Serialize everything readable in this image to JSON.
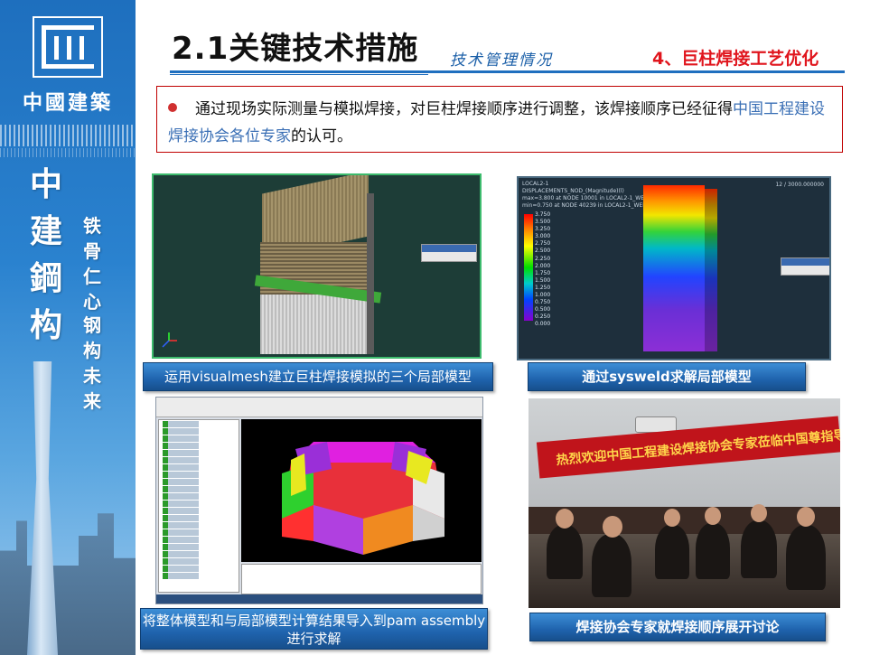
{
  "sidebar": {
    "brand_cn": "中國建築",
    "big_chars": [
      "中",
      "建",
      "鋼",
      "构"
    ],
    "motto_col1": [
      "铁",
      "骨",
      "仁",
      "心"
    ],
    "motto_col2": [
      "钢",
      "构",
      "未",
      "来"
    ]
  },
  "header": {
    "title": "2.1关键技术措施",
    "subtitle": "技术管理情况",
    "section_label": "4、巨柱焊接工艺优化"
  },
  "intro": {
    "text_main": "通过现场实际测量与模拟焊接，对巨柱焊接顺序进行调整，该焊接顺序已经征得",
    "text_highlight": "中国工程建设焊接协会各位专家",
    "text_end": "的认可。"
  },
  "panels": {
    "cap1": "运用visualmesh建立巨柱焊接模拟的三个局部模型",
    "cap2": "通过sysweld求解局部模型",
    "cap3": "将整体模型和与局部模型计算结果导入到pam assembly 进行求解",
    "cap4": "焊接协会专家就焊接顺序展开讨论"
  },
  "img2": {
    "header_lines": [
      "LOCAL2-1",
      "DISPLACEMENTS_NOD_(Magnitude)(l)",
      "max=3.800 at NODE 10001 in LOCAL2-1_WELD_4_POST3000.fdb",
      "min=0.750 at NODE 40239 in LOCAL2-1_WELD_4_POST3000.fdb"
    ],
    "frame": "12 / 3000.000000",
    "legend_values": [
      "3.750",
      "3.500",
      "3.250",
      "3.000",
      "2.750",
      "2.500",
      "2.250",
      "2.000",
      "1.750",
      "1.500",
      "1.250",
      "1.000",
      "0.750",
      "0.500",
      "0.250",
      "0.000"
    ]
  },
  "img4": {
    "banner": "热烈欢迎中国工程建设焊接协会专家莅临中国尊指导"
  },
  "colors": {
    "accent_blue": "#1f6fbf",
    "section_red": "#e0151d",
    "highlight_blue": "#3a6fb5"
  }
}
